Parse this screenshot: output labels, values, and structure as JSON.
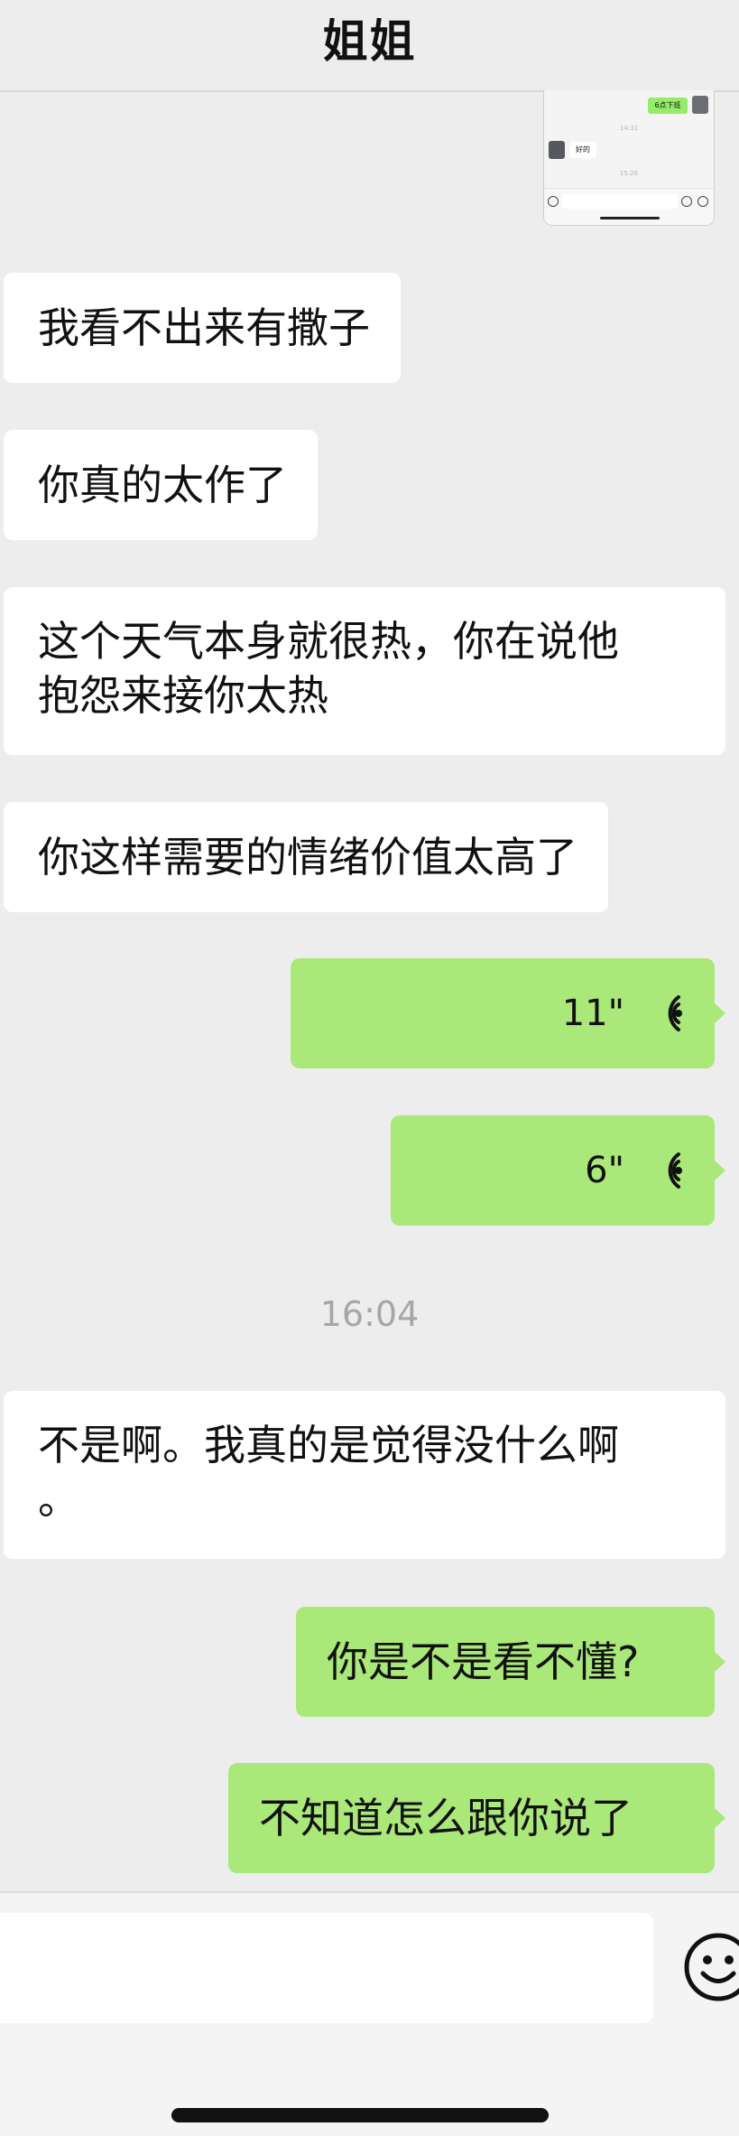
{
  "header": {
    "title": "姐姐"
  },
  "thumbnail": {
    "green_text": "6点下班",
    "white_text": "好的",
    "time_a": "14:31",
    "time_b": "15:26"
  },
  "messages": [
    {
      "side": "left",
      "text": "我看不出来有撒子"
    },
    {
      "side": "left",
      "text": "你真的太作了"
    },
    {
      "side": "left",
      "line1": "这个天气本身就很热，你在说他",
      "line2": "抱怨来接你太热"
    },
    {
      "side": "left",
      "text": "你这样需要的情绪价值太高了"
    },
    {
      "side": "right",
      "type": "voice",
      "duration": "11\""
    },
    {
      "side": "right",
      "type": "voice",
      "duration": "6\""
    },
    {
      "type": "timestamp",
      "text": "16:04"
    },
    {
      "side": "left",
      "line1": "不是啊。我真的是觉得没什么啊",
      "line2": "。"
    },
    {
      "side": "right",
      "text": "你是不是看不懂?"
    },
    {
      "side": "right",
      "text": "不知道怎么跟你说了"
    }
  ],
  "colors": {
    "background": "#ededed",
    "sent_bubble": "#a9e879",
    "received_bubble": "#ffffff",
    "timestamp": "#a6a6a6"
  },
  "icons": {
    "voice_wave": "voice-wave-icon",
    "emoji": "emoji-icon"
  }
}
